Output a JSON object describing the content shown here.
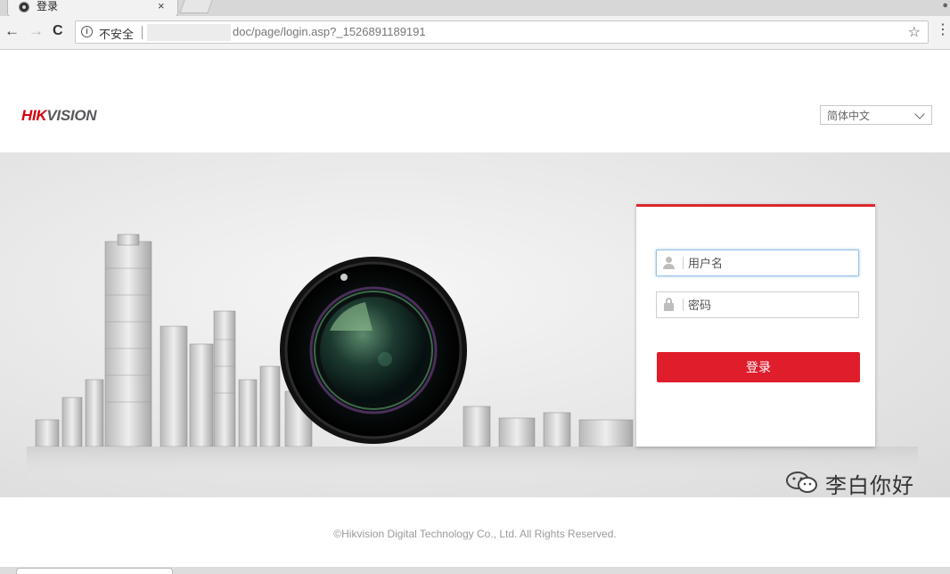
{
  "browser": {
    "tab_title": "登录",
    "tab_close": "×",
    "security_label": "不安全",
    "url_visible": "doc/page/login.asp?_1526891189191",
    "back_glyph": "←",
    "forward_glyph": "→",
    "reload_glyph": "C",
    "star_glyph": "☆",
    "menu_glyph": "⋮"
  },
  "header": {
    "logo_red": "HIK",
    "logo_gray": "VISION",
    "language": "简体中文"
  },
  "login": {
    "username_placeholder": "用户名",
    "password_placeholder": "密码",
    "submit_label": "登录"
  },
  "footer": {
    "copyright": "©Hikvision Digital Technology Co., Ltd. All Rights Reserved."
  },
  "watermark": {
    "text": "李白你好"
  },
  "colors": {
    "brand_red": "#d7000f",
    "button_red": "#df1d2b",
    "card_top_border": "#d9282f"
  }
}
